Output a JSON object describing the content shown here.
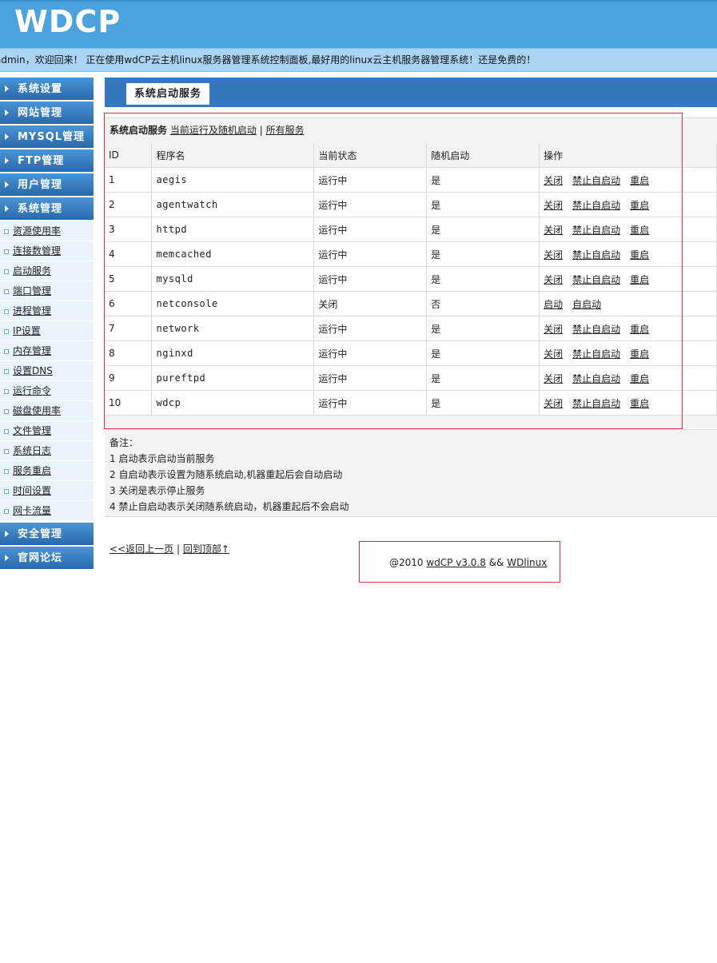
{
  "header": {
    "logo": "WDCP"
  },
  "welcome": "admin，欢迎回来！ 正在使用wdCP云主机linux服务器管理系统控制面板,最好用的linux云主机服务器管理系统！还是免费的！",
  "sidebar": {
    "sections_top": [
      "系统设置",
      "网站管理",
      "MYSQL管理",
      "FTP管理",
      "用户管理",
      "系统管理"
    ],
    "sub_items": [
      "资源使用率",
      "连接数管理",
      "启动服务",
      "端口管理",
      "进程管理",
      "IP设置",
      "内存管理",
      "设置DNS",
      "运行命令",
      "磁盘使用率",
      "文件管理",
      "系统日志",
      "服务重启",
      "时间设置",
      "网卡流量"
    ],
    "sections_bottom": [
      "安全管理",
      "官网论坛"
    ]
  },
  "main": {
    "tab_title": "系统启动服务",
    "panel_title": "系统启动服务",
    "filter_current": "当前运行及随机启动",
    "filter_sep": "|",
    "filter_all": "所有服务",
    "columns": [
      "ID",
      "程序名",
      "当前状态",
      "随机启动",
      "操作"
    ],
    "rows": [
      {
        "id": "1",
        "name": "aegis",
        "status": "运行中",
        "autostart": "是",
        "ops": [
          "关闭",
          "禁止自启动",
          "重启"
        ]
      },
      {
        "id": "2",
        "name": "agentwatch",
        "status": "运行中",
        "autostart": "是",
        "ops": [
          "关闭",
          "禁止自启动",
          "重启"
        ]
      },
      {
        "id": "3",
        "name": "httpd",
        "status": "运行中",
        "autostart": "是",
        "ops": [
          "关闭",
          "禁止自启动",
          "重启"
        ]
      },
      {
        "id": "4",
        "name": "memcached",
        "status": "运行中",
        "autostart": "是",
        "ops": [
          "关闭",
          "禁止自启动",
          "重启"
        ]
      },
      {
        "id": "5",
        "name": "mysqld",
        "status": "运行中",
        "autostart": "是",
        "ops": [
          "关闭",
          "禁止自启动",
          "重启"
        ]
      },
      {
        "id": "6",
        "name": "netconsole",
        "status": "关闭",
        "autostart": "否",
        "ops": [
          "启动",
          "自启动"
        ]
      },
      {
        "id": "7",
        "name": "network",
        "status": "运行中",
        "autostart": "是",
        "ops": [
          "关闭",
          "禁止自启动",
          "重启"
        ]
      },
      {
        "id": "8",
        "name": "nginxd",
        "status": "运行中",
        "autostart": "是",
        "ops": [
          "关闭",
          "禁止自启动",
          "重启"
        ]
      },
      {
        "id": "9",
        "name": "pureftpd",
        "status": "运行中",
        "autostart": "是",
        "ops": [
          "关闭",
          "禁止自启动",
          "重启"
        ]
      },
      {
        "id": "10",
        "name": "wdcp",
        "status": "运行中",
        "autostart": "是",
        "ops": [
          "关闭",
          "禁止自启动",
          "重启"
        ]
      }
    ],
    "notes": {
      "title": "备注：",
      "lines": [
        "1 启动表示启动当前服务",
        "2 自启动表示设置为随系统启动,机器重起后会自动启动",
        "3 关闭是表示停止服务",
        "4 禁止自启动表示关闭随系统启动，机器重起后不会启动"
      ]
    },
    "back_link": "<<返回上一页",
    "back_sep": "|",
    "top_link": "回到顶部↑"
  },
  "footer": {
    "prefix": "@2010",
    "product_link": "wdCP v3.0.8",
    "amp": "&&",
    "brand_link": "WDlinux"
  },
  "colors": {
    "header_blue": "#4ba2dd",
    "welcome_bar": "#a9d4f3",
    "sidebar_blue": "#2d78bc",
    "highlight_red": "#d9363e"
  }
}
